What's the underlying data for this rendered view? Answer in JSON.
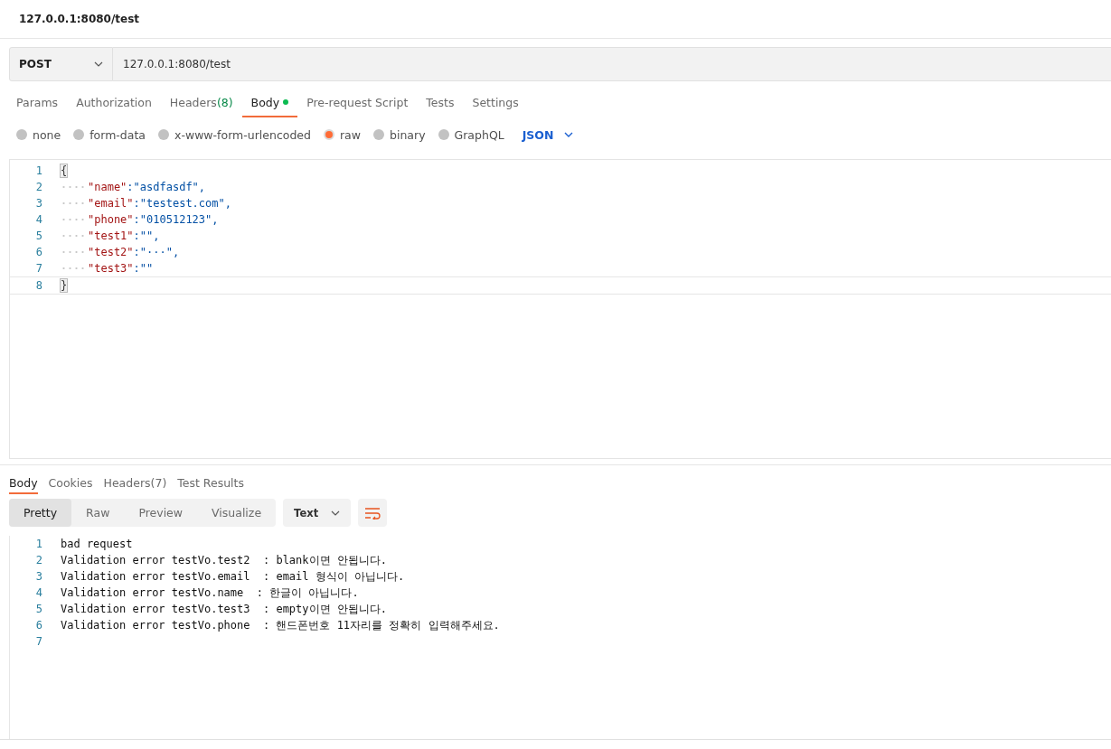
{
  "title": "127.0.0.1:8080/test",
  "request": {
    "method": "POST",
    "url": "127.0.0.1:8080/test"
  },
  "request_tabs": [
    {
      "label": "Params",
      "selected": false,
      "dot": false
    },
    {
      "label": "Authorization",
      "selected": false,
      "dot": false
    },
    {
      "label": "Headers",
      "count": "(8)",
      "selected": false,
      "dot": false
    },
    {
      "label": "Body",
      "selected": true,
      "dot": true
    },
    {
      "label": "Pre-request Script",
      "selected": false,
      "dot": false
    },
    {
      "label": "Tests",
      "selected": false,
      "dot": false
    },
    {
      "label": "Settings",
      "selected": false,
      "dot": false
    }
  ],
  "body_types": [
    {
      "label": "none",
      "selected": false
    },
    {
      "label": "form-data",
      "selected": false
    },
    {
      "label": "x-www-form-urlencoded",
      "selected": false
    },
    {
      "label": "raw",
      "selected": true
    },
    {
      "label": "binary",
      "selected": false
    },
    {
      "label": "GraphQL",
      "selected": false
    }
  ],
  "body_format": "JSON",
  "editor_lines": [
    {
      "number": "1",
      "kind": "brace",
      "text": "{"
    },
    {
      "number": "2",
      "kind": "pair",
      "key": "\"name\"",
      "value": ":\"asdfasdf\","
    },
    {
      "number": "3",
      "kind": "pair",
      "key": "\"email\"",
      "value": ":\"testest.com\","
    },
    {
      "number": "4",
      "kind": "pair",
      "key": "\"phone\"",
      "value": ":\"010512123\","
    },
    {
      "number": "5",
      "kind": "pair",
      "key": "\"test1\"",
      "value": ":\"\","
    },
    {
      "number": "6",
      "kind": "pair",
      "key": "\"test2\"",
      "value": ":\"···\","
    },
    {
      "number": "7",
      "kind": "pair",
      "key": "\"test3\"",
      "value": ":\"\""
    },
    {
      "number": "8",
      "kind": "brace",
      "text": "}"
    }
  ],
  "response_tabs": [
    {
      "label": "Body",
      "selected": true
    },
    {
      "label": "Cookies",
      "selected": false
    },
    {
      "label": "Headers",
      "count": "(7)",
      "selected": false
    },
    {
      "label": "Test Results",
      "selected": false
    }
  ],
  "view_modes": [
    {
      "label": "Pretty",
      "selected": true
    },
    {
      "label": "Raw",
      "selected": false
    },
    {
      "label": "Preview",
      "selected": false
    },
    {
      "label": "Visualize",
      "selected": false
    }
  ],
  "response_format": "Text",
  "response_lines": [
    {
      "number": "1",
      "text": "bad request"
    },
    {
      "number": "2",
      "text": "Validation error testVo.test2  : blank이면 안됩니다."
    },
    {
      "number": "3",
      "text": "Validation error testVo.email  : email 형식이 아닙니다."
    },
    {
      "number": "4",
      "text": "Validation error testVo.name  : 한글이 아닙니다."
    },
    {
      "number": "5",
      "text": "Validation error testVo.test3  : empty이면 안됩니다."
    },
    {
      "number": "6",
      "text": "Validation error testVo.phone  : 핸드폰번호 11자리를 정확히 입력해주세요."
    },
    {
      "number": "7"
    }
  ]
}
